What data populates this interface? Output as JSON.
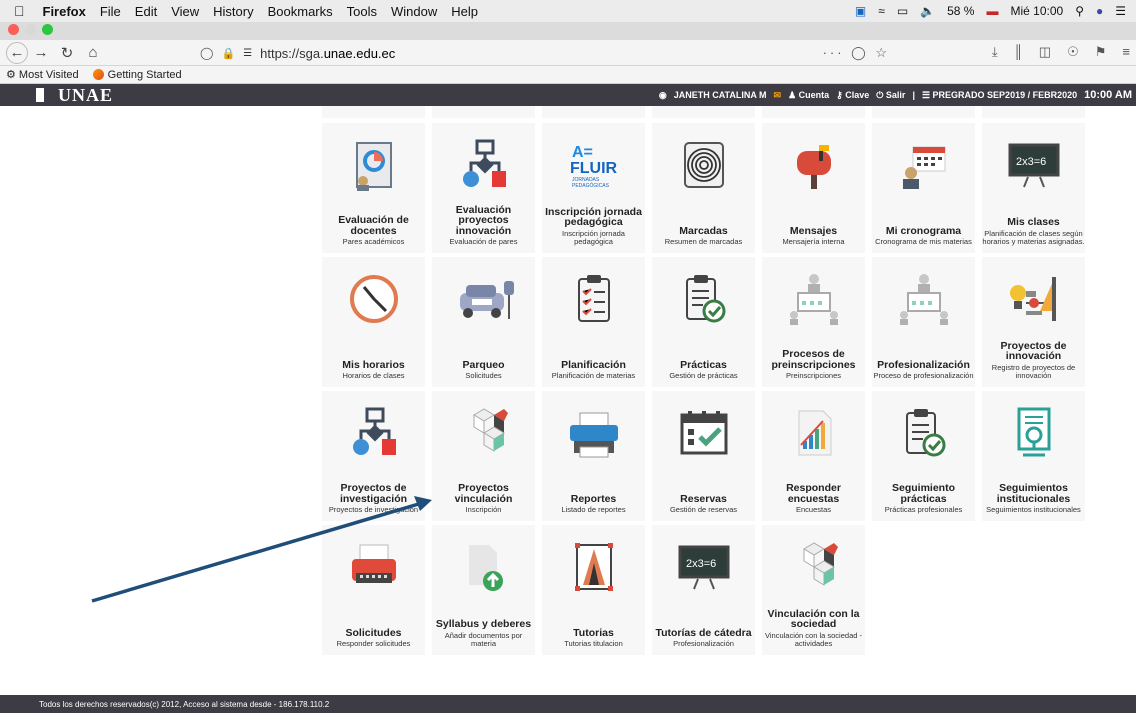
{
  "os_menubar": {
    "app": "Firefox",
    "items": [
      "File",
      "Edit",
      "View",
      "History",
      "Bookmarks",
      "Tools",
      "Window",
      "Help"
    ],
    "battery": "58 %",
    "clock": "Mié 10:00"
  },
  "browser": {
    "url_prefix": "https://sga.",
    "url_domain": "unae.edu.ec",
    "more": "···",
    "bookmarks": [
      "Most Visited",
      "Getting Started"
    ]
  },
  "app": {
    "logo": "UNAE",
    "user": "JANETH CATALINA M",
    "account": "Cuenta",
    "key": "Clave",
    "logout": "Salir",
    "period": "PREGRADO SEP2019 / FEBR2020",
    "time": "10:00 AM"
  },
  "modules": [
    {
      "title": "Evaluación de docentes",
      "sub": "Pares académicos",
      "icon": "evaluation-chart-icon"
    },
    {
      "title": "Evaluación proyectos innovación",
      "sub": "Evaluación de pares",
      "icon": "flowchart-icon"
    },
    {
      "title": "Inscripción jornada pedagógica",
      "sub": "Inscripción jornada pedagógica",
      "icon": "afluir-logo-icon"
    },
    {
      "title": "Marcadas",
      "sub": "Resumen de marcadas",
      "icon": "fingerprint-icon"
    },
    {
      "title": "Mensajes",
      "sub": "Mensajería interna",
      "icon": "mailbox-icon"
    },
    {
      "title": "Mi cronograma",
      "sub": "Cronograma de mis materias",
      "icon": "calendar-person-icon"
    },
    {
      "title": "Mis clases",
      "sub": "Planificación de clases según horarios y materias asignadas.",
      "icon": "chalkboard-icon"
    },
    {
      "title": "Mis horarios",
      "sub": "Horarios de clases",
      "icon": "clock-icon"
    },
    {
      "title": "Parqueo",
      "sub": "Solicitudes",
      "icon": "parking-car-icon"
    },
    {
      "title": "Planificación",
      "sub": "Planificación de materias",
      "icon": "checklist-icon"
    },
    {
      "title": "Prácticas",
      "sub": "Gestión de prácticas",
      "icon": "clipboard-check-icon"
    },
    {
      "title": "Procesos de preinscripciones",
      "sub": "Preinscripciones",
      "icon": "network-people-icon"
    },
    {
      "title": "Profesionalización",
      "sub": "Proceso de profesionalización",
      "icon": "network-people-icon"
    },
    {
      "title": "Proyectos de innovación",
      "sub": "Registro de proyectos de innovación",
      "icon": "idea-tools-icon"
    },
    {
      "title": "Proyectos de investigación",
      "sub": "Proyectos de investigación",
      "icon": "flowchart-icon"
    },
    {
      "title": "Proyectos vinculación",
      "sub": "Inscripción",
      "icon": "cubes-icon"
    },
    {
      "title": "Reportes",
      "sub": "Listado de reportes",
      "icon": "printer-icon"
    },
    {
      "title": "Reservas",
      "sub": "Gestión de reservas",
      "icon": "calendar-check-icon"
    },
    {
      "title": "Responder encuestas",
      "sub": "Encuestas",
      "icon": "survey-chart-icon"
    },
    {
      "title": "Seguimiento prácticas",
      "sub": "Prácticas profesionales",
      "icon": "clipboard-check-icon"
    },
    {
      "title": "Seguimientos institucionales",
      "sub": "Seguimientos institucionales",
      "icon": "document-search-icon"
    },
    {
      "title": "Solicitudes",
      "sub": "Responder solicitudes",
      "icon": "typewriter-icon"
    },
    {
      "title": "Syllabus y deberes",
      "sub": "Añadir documentos por materia",
      "icon": "upload-document-icon"
    },
    {
      "title": "Tutorias",
      "sub": "Tutorias titulacion",
      "icon": "framed-a-icon"
    },
    {
      "title": "Tutorías de cátedra",
      "sub": "Profesionalización",
      "icon": "chalkboard-icon"
    },
    {
      "title": "Vinculación con la sociedad",
      "sub": "Vinculación con la sociedad - actividades",
      "icon": "cubes-icon"
    }
  ],
  "footer": "Todos los derechos reservados(c) 2012, Acceso al sistema desde - 186.178.110.2"
}
